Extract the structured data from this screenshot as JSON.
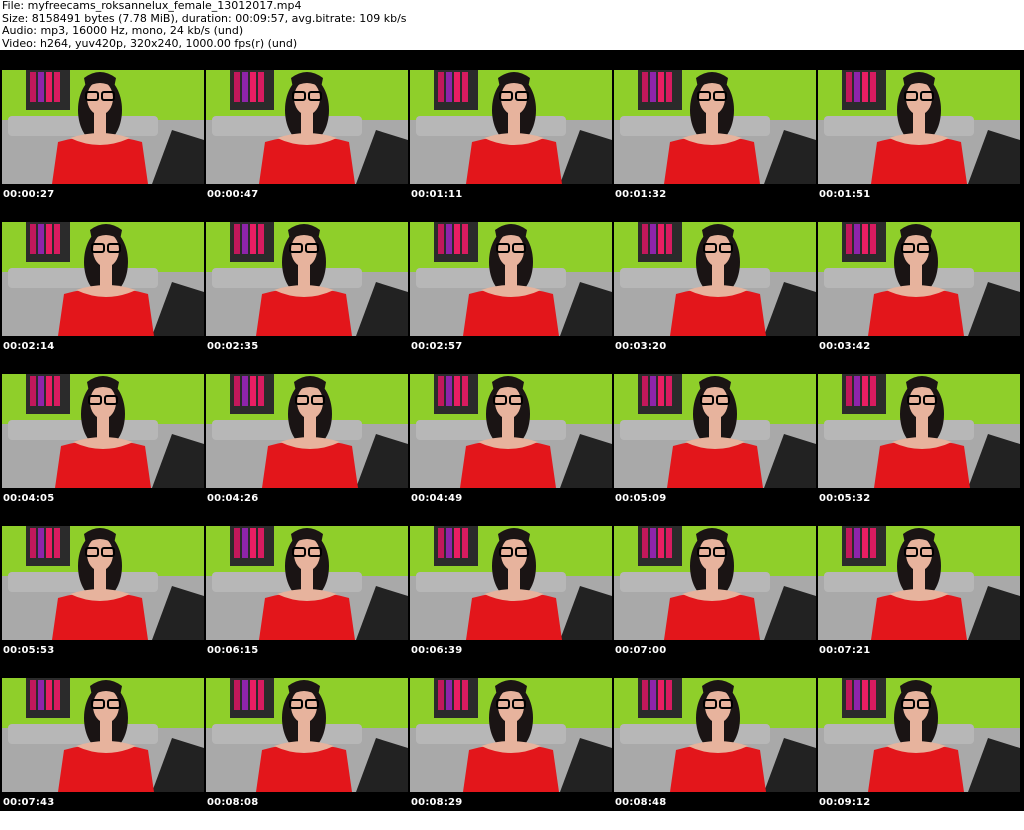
{
  "header": {
    "file": "File: myfreecams_roksannelux_female_13012017.mp4",
    "size": "Size: 8158491 bytes (7.78 MiB), duration: 00:09:57, avg.bitrate: 109 kb/s",
    "audio": "Audio: mp3, 16000 Hz, mono, 24 kb/s (und)",
    "video": "Video: h264, yuv420p, 320x240, 1000.00 fps(r) (und)"
  },
  "colors": {
    "background": "#000000",
    "wall": "#8fcf2a",
    "sofa": "#a9a9a9",
    "top": "#e3161b",
    "hair": "#1a1414",
    "skin": "#e7b39d",
    "timestamp": "#ffffff"
  },
  "thumbnails": [
    {
      "time": "00:00:27"
    },
    {
      "time": "00:00:47"
    },
    {
      "time": "00:01:11"
    },
    {
      "time": "00:01:32"
    },
    {
      "time": "00:01:51"
    },
    {
      "time": "00:02:14"
    },
    {
      "time": "00:02:35"
    },
    {
      "time": "00:02:57"
    },
    {
      "time": "00:03:20"
    },
    {
      "time": "00:03:42"
    },
    {
      "time": "00:04:05"
    },
    {
      "time": "00:04:26"
    },
    {
      "time": "00:04:49"
    },
    {
      "time": "00:05:09"
    },
    {
      "time": "00:05:32"
    },
    {
      "time": "00:05:53"
    },
    {
      "time": "00:06:15"
    },
    {
      "time": "00:06:39"
    },
    {
      "time": "00:07:00"
    },
    {
      "time": "00:07:21"
    },
    {
      "time": "00:07:43"
    },
    {
      "time": "00:08:08"
    },
    {
      "time": "00:08:29"
    },
    {
      "time": "00:08:48"
    },
    {
      "time": "00:09:12"
    }
  ]
}
